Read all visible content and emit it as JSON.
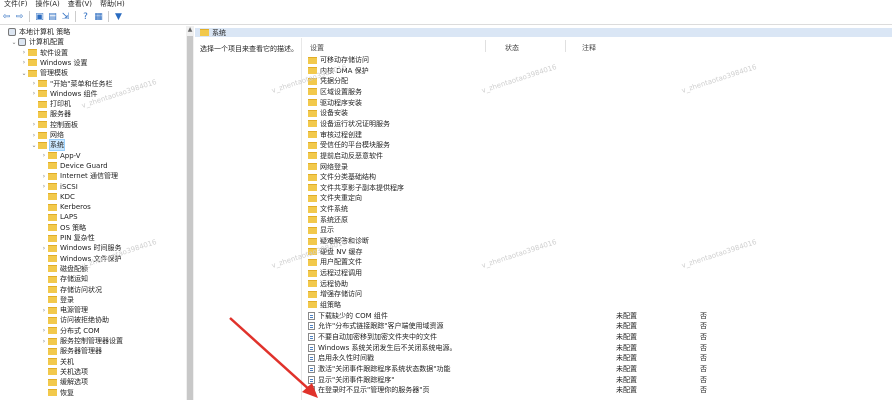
{
  "menu": [
    "文件(F)",
    "操作(A)",
    "查看(V)",
    "帮助(H)"
  ],
  "toolbar_icons": [
    "back-icon",
    "forward-icon",
    "up-folder-icon",
    "show-tree-icon",
    "export-icon",
    "help-icon",
    "properties-icon",
    "filter-icon"
  ],
  "tree": {
    "items": [
      {
        "label": "本地计算机 策略",
        "indent": 0,
        "chev": "",
        "icon": "computer"
      },
      {
        "label": "计算机配置",
        "indent": 1,
        "chev": "v",
        "icon": "computer"
      },
      {
        "label": "软件设置",
        "indent": 2,
        "chev": ">",
        "icon": "folder"
      },
      {
        "label": "Windows 设置",
        "indent": 2,
        "chev": ">",
        "icon": "folder"
      },
      {
        "label": "管理模板",
        "indent": 2,
        "chev": "v",
        "icon": "folder"
      },
      {
        "label": "\"开始\"菜单和任务栏",
        "indent": 3,
        "chev": ">",
        "icon": "folder"
      },
      {
        "label": "Windows 组件",
        "indent": 3,
        "chev": ">",
        "icon": "folder"
      },
      {
        "label": "打印机",
        "indent": 3,
        "chev": "",
        "icon": "folder"
      },
      {
        "label": "服务器",
        "indent": 3,
        "chev": "",
        "icon": "folder"
      },
      {
        "label": "控制面板",
        "indent": 3,
        "chev": ">",
        "icon": "folder"
      },
      {
        "label": "网络",
        "indent": 3,
        "chev": ">",
        "icon": "folder"
      },
      {
        "label": "系统",
        "indent": 3,
        "chev": "v",
        "icon": "folder",
        "selected": true
      },
      {
        "label": "App-V",
        "indent": 4,
        "chev": ">",
        "icon": "folder"
      },
      {
        "label": "Device Guard",
        "indent": 4,
        "chev": "",
        "icon": "folder"
      },
      {
        "label": "Internet 通信管理",
        "indent": 4,
        "chev": ">",
        "icon": "folder"
      },
      {
        "label": "iSCSI",
        "indent": 4,
        "chev": ">",
        "icon": "folder"
      },
      {
        "label": "KDC",
        "indent": 4,
        "chev": "",
        "icon": "folder"
      },
      {
        "label": "Kerberos",
        "indent": 4,
        "chev": "",
        "icon": "folder"
      },
      {
        "label": "LAPS",
        "indent": 4,
        "chev": "",
        "icon": "folder"
      },
      {
        "label": "OS 策略",
        "indent": 4,
        "chev": "",
        "icon": "folder"
      },
      {
        "label": "PIN 复杂性",
        "indent": 4,
        "chev": "",
        "icon": "folder"
      },
      {
        "label": "Windows 时间服务",
        "indent": 4,
        "chev": ">",
        "icon": "folder"
      },
      {
        "label": "Windows 文件保护",
        "indent": 4,
        "chev": "",
        "icon": "folder"
      },
      {
        "label": "磁盘配额",
        "indent": 4,
        "chev": "",
        "icon": "folder"
      },
      {
        "label": "存储运知",
        "indent": 4,
        "chev": "",
        "icon": "folder"
      },
      {
        "label": "存储访问状况",
        "indent": 4,
        "chev": "",
        "icon": "folder"
      },
      {
        "label": "登录",
        "indent": 4,
        "chev": "",
        "icon": "folder"
      },
      {
        "label": "电源管理",
        "indent": 4,
        "chev": ">",
        "icon": "folder"
      },
      {
        "label": "访问被拒绝协助",
        "indent": 4,
        "chev": "",
        "icon": "folder"
      },
      {
        "label": "分布式 COM",
        "indent": 4,
        "chev": ">",
        "icon": "folder"
      },
      {
        "label": "服务控制管理器设置",
        "indent": 4,
        "chev": ">",
        "icon": "folder"
      },
      {
        "label": "服务器管理器",
        "indent": 4,
        "chev": "",
        "icon": "folder"
      },
      {
        "label": "关机",
        "indent": 4,
        "chev": "",
        "icon": "folder"
      },
      {
        "label": "关机选项",
        "indent": 4,
        "chev": "",
        "icon": "folder"
      },
      {
        "label": "缓解选项",
        "indent": 4,
        "chev": "",
        "icon": "folder"
      },
      {
        "label": "恢复",
        "indent": 4,
        "chev": "",
        "icon": "folder"
      }
    ]
  },
  "right": {
    "header_title": "系统",
    "description": "选择一个项目来查看它的描述。",
    "columns": {
      "setting": "设置",
      "state": "状态",
      "note": "注释"
    },
    "folders": [
      "可移动存储访问",
      "内核 DMA 保护",
      "凭据分配",
      "区域设置服务",
      "驱动程序安装",
      "设备安装",
      "设备运行状况证明服务",
      "审核过程创建",
      "受信任的平台模块服务",
      "提前启动反恶意软件",
      "网络登录",
      "文件分类基础结构",
      "文件共享影子副本提供程序",
      "文件夹重定向",
      "文件系统",
      "系统还原",
      "显示",
      "疑难解答和诊断",
      "硬盘 NV 缓存",
      "用户配置文件",
      "远程过程调用",
      "远程协助",
      "增强存储访问",
      "组策略"
    ],
    "policies": [
      {
        "name": "下载缺少的 COM 组件",
        "state": "未配置",
        "note": "否"
      },
      {
        "name": "允许\"分布式链接跟踪\"客户端使用域资源",
        "state": "未配置",
        "note": "否"
      },
      {
        "name": "不要自动加密移到加密文件夹中的文件",
        "state": "未配置",
        "note": "否"
      },
      {
        "name": "Windows 系统关闭发生后不关闭系统电源。",
        "state": "未配置",
        "note": "否"
      },
      {
        "name": "启用永久性时间戳",
        "state": "未配置",
        "note": "否"
      },
      {
        "name": "激活\"关闭事件跟踪程序系统状态数据\"功能",
        "state": "未配置",
        "note": "否"
      },
      {
        "name": "显示\"关闭事件跟踪程序\"",
        "state": "未配置",
        "note": "否"
      },
      {
        "name": "在登录时不显示\"管理你的服务器\"页",
        "state": "未配置",
        "note": "否"
      }
    ]
  },
  "watermark": "v_zhentaotao3984016",
  "colors": {
    "selection": "#cce8ff",
    "header": "#dae6f5",
    "folder": "#f2c94c",
    "arrow": "#e0322b"
  }
}
